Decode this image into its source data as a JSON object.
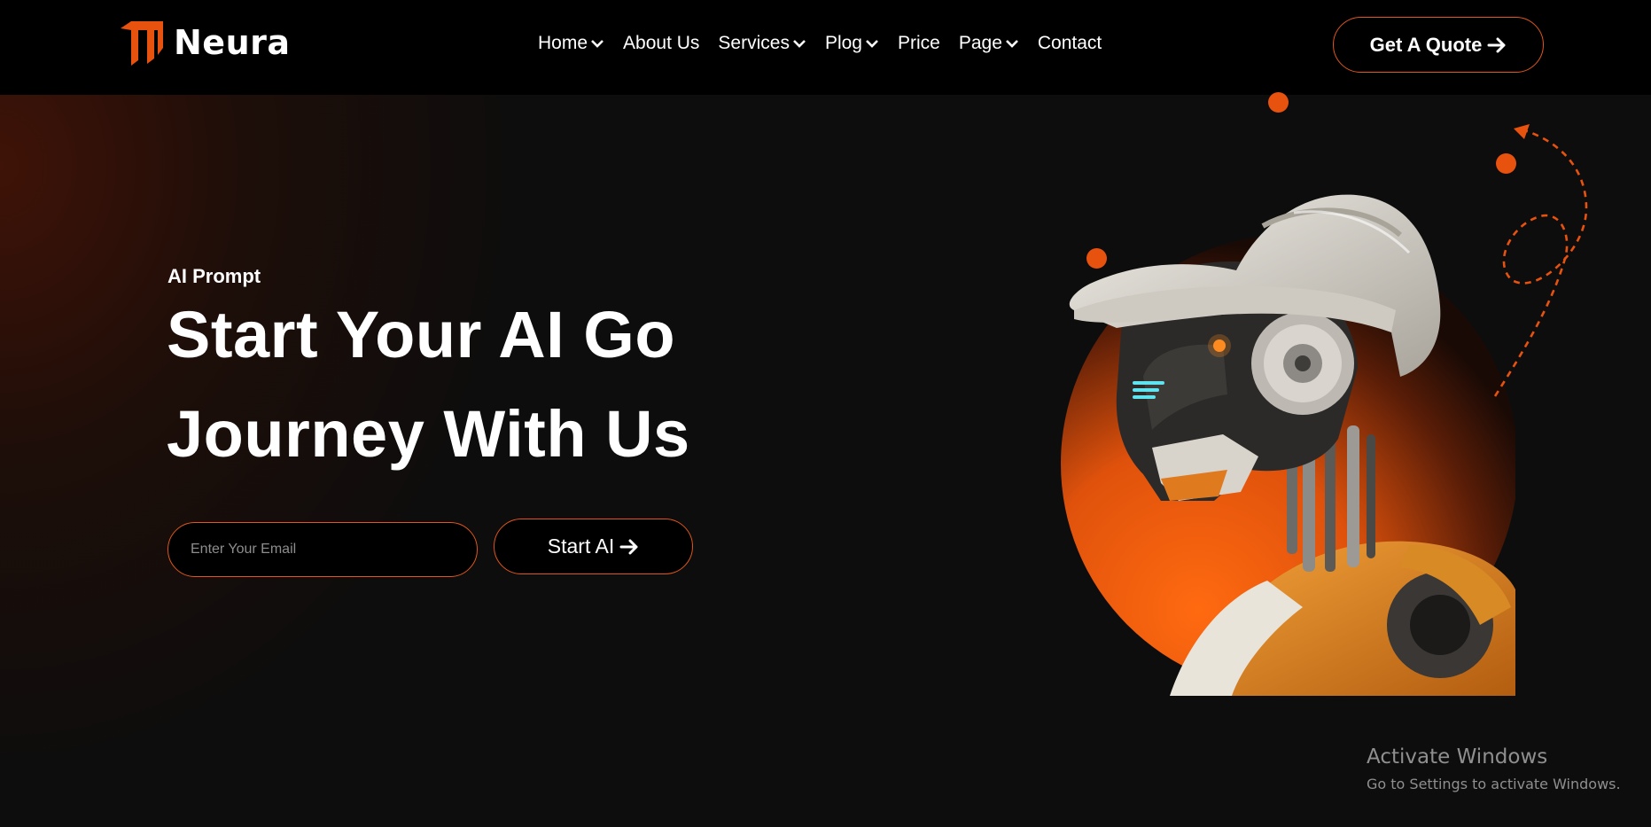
{
  "brand": {
    "name": "Neura",
    "accent": "#e8520f"
  },
  "nav": {
    "items": [
      {
        "label": "Home",
        "dropdown": true
      },
      {
        "label": "About Us",
        "dropdown": false
      },
      {
        "label": "Services",
        "dropdown": true
      },
      {
        "label": "Plog",
        "dropdown": true
      },
      {
        "label": "Price",
        "dropdown": false
      },
      {
        "label": "Page",
        "dropdown": true
      },
      {
        "label": "Contact",
        "dropdown": false
      }
    ],
    "cta_label": "Get A Quote"
  },
  "hero": {
    "eyebrow": "AI Prompt",
    "headline_line1": "Start Your AI Go",
    "headline_line2": "Journey With Us",
    "email_placeholder": "Enter Your Email",
    "start_label": "Start AI"
  },
  "watermark": {
    "title": "Activate Windows",
    "subtitle": "Go to Settings to activate Windows."
  }
}
